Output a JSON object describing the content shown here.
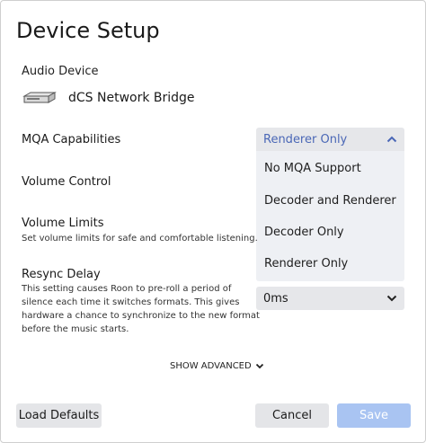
{
  "dialog": {
    "title": "Device Setup",
    "audio_device_label": "Audio Device",
    "device_name": "dCS Network Bridge",
    "mqa": {
      "label": "MQA Capabilities",
      "selected": "Renderer Only",
      "options": [
        "No MQA Support",
        "Decoder and Renderer",
        "Decoder Only",
        "Renderer Only"
      ]
    },
    "volume_control": {
      "label": "Volume Control"
    },
    "volume_limits": {
      "label": "Volume Limits",
      "description": "Set volume limits for safe and comfortable listening."
    },
    "resync_delay": {
      "label": "Resync Delay",
      "description_lines": [
        "This setting causes Roon to pre-roll a period of",
        "silence each time it switches formats. This gives",
        "hardware a chance to synchronize to the new format",
        "before the music starts."
      ],
      "value": "0ms"
    },
    "show_advanced": "SHOW ADVANCED",
    "buttons": {
      "load_defaults": "Load Defaults",
      "cancel": "Cancel",
      "save": "Save"
    }
  },
  "colors": {
    "accent": "#4a67b6",
    "save_disabled": "#a9c4f2",
    "button_gray": "#e4e5e8",
    "menu_bg": "#eef0f4"
  },
  "icons": {
    "device": "network-bridge-device-icon",
    "dropdown_open": "chevron-up-icon",
    "dropdown_closed": "chevron-down-icon",
    "show_advanced": "chevron-down-icon"
  }
}
